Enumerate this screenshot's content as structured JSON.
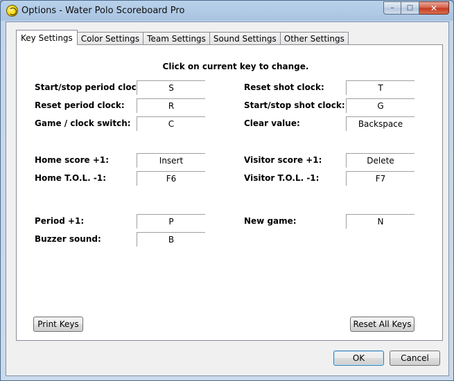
{
  "window": {
    "title": "Options - Water Polo Scoreboard Pro",
    "minimize_glyph": "–",
    "maximize_glyph": "□",
    "close_glyph": "✕"
  },
  "tabs": [
    {
      "label": "Key Settings",
      "active": true
    },
    {
      "label": "Color Settings",
      "active": false
    },
    {
      "label": "Team Settings",
      "active": false
    },
    {
      "label": "Sound Settings",
      "active": false
    },
    {
      "label": "Other Settings",
      "active": false
    }
  ],
  "instruction": "Click on current key to change.",
  "left_keys": [
    {
      "label": "Start/stop period clock:",
      "key": "S"
    },
    {
      "label": "Reset period clock:",
      "key": "R"
    },
    {
      "label": "Game / clock switch:",
      "key": "C"
    },
    {
      "label": "Home score +1:",
      "key": "Insert"
    },
    {
      "label": "Home T.O.L. -1:",
      "key": "F6"
    },
    {
      "label": "Period +1:",
      "key": "P"
    },
    {
      "label": "Buzzer sound:",
      "key": "B"
    }
  ],
  "right_keys": [
    {
      "label": "Reset shot clock:",
      "key": "T"
    },
    {
      "label": "Start/stop shot clock:",
      "key": "G"
    },
    {
      "label": "Clear value:",
      "key": "Backspace"
    },
    {
      "label": "Visitor score +1:",
      "key": "Delete"
    },
    {
      "label": "Visitor T.O.L. -1:",
      "key": "F7"
    },
    {
      "label": "New game:",
      "key": "N"
    }
  ],
  "buttons": {
    "print_keys": "Print Keys",
    "reset_all_keys": "Reset All Keys",
    "ok": "OK",
    "cancel": "Cancel"
  }
}
